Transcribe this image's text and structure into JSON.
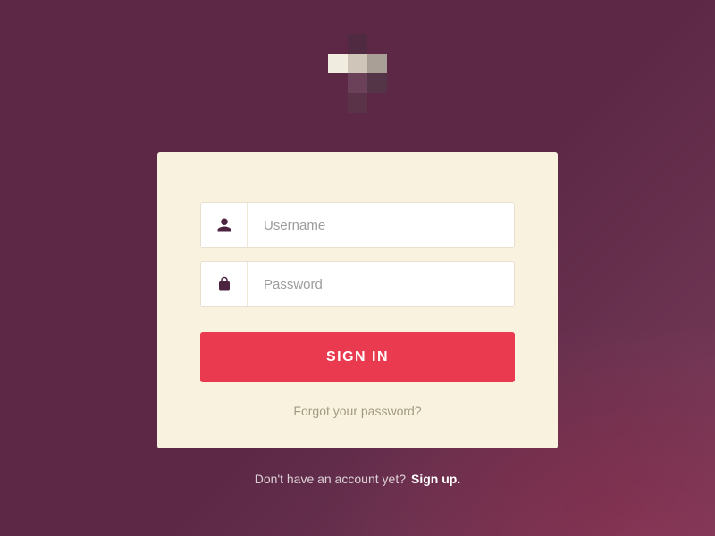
{
  "form": {
    "username_placeholder": "Username",
    "password_placeholder": "Password",
    "signin_label": "SIGN IN",
    "forgot_label": "Forgot your password?"
  },
  "signup": {
    "prompt": "Don't have an account yet?",
    "link": "Sign up."
  },
  "logo": {
    "cells": [
      "transparent",
      "#4f2a40",
      "transparent",
      "#f1ece0",
      "#cfc6b9",
      "#a99f96",
      "transparent",
      "#6a4158",
      "#543447",
      "transparent",
      "#5a3349",
      "transparent"
    ]
  },
  "colors": {
    "background": "#5d2a47",
    "card": "#f9f2de",
    "accent": "#ea3a4f",
    "icon": "#4d2440"
  }
}
